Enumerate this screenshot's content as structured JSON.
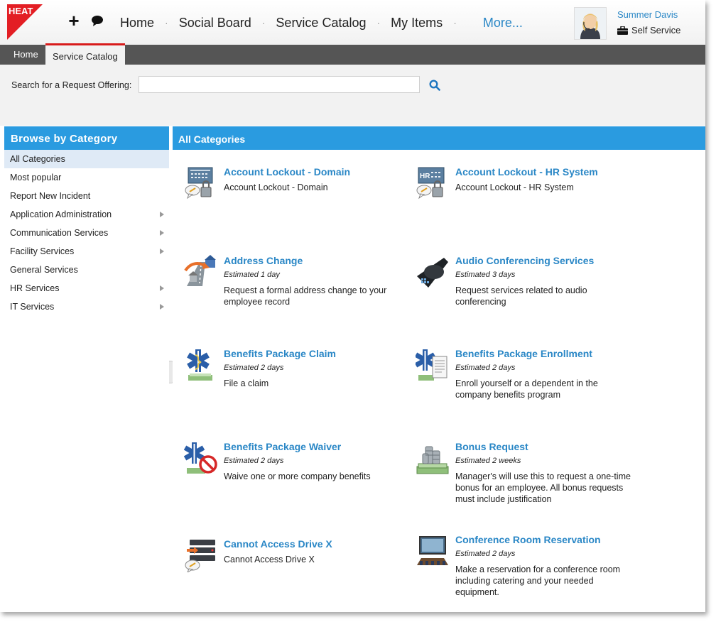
{
  "app": {
    "logo_text": "HEAT",
    "brand_color": "#e31e24",
    "accent_color": "#2a9be0"
  },
  "header": {
    "add_icon": "plus-icon",
    "chat_icon": "speech-bubble-icon",
    "nav": [
      {
        "label": "Home"
      },
      {
        "label": "Social Board"
      },
      {
        "label": "Service Catalog"
      },
      {
        "label": "My Items"
      }
    ],
    "more_label": "More...",
    "user": {
      "name": "Summer Davis",
      "role": "Self Service",
      "role_icon": "briefcase-icon"
    }
  },
  "tabs": {
    "home": "Home",
    "active": "Service Catalog"
  },
  "search": {
    "label": "Search for a Request Offering:",
    "value": "",
    "placeholder": "",
    "icon": "search-icon"
  },
  "sidebar": {
    "title": "Browse by Category",
    "items": [
      {
        "label": "All Categories",
        "selected": true,
        "has_children": false
      },
      {
        "label": "Most popular",
        "selected": false,
        "has_children": false
      },
      {
        "label": "Report New Incident",
        "selected": false,
        "has_children": false
      },
      {
        "label": "Application Administration",
        "selected": false,
        "has_children": true
      },
      {
        "label": "Communication Services",
        "selected": false,
        "has_children": true
      },
      {
        "label": "Facility Services",
        "selected": false,
        "has_children": true
      },
      {
        "label": "General Services",
        "selected": false,
        "has_children": false
      },
      {
        "label": "HR Services",
        "selected": false,
        "has_children": true
      },
      {
        "label": "IT Services",
        "selected": false,
        "has_children": true
      }
    ]
  },
  "main": {
    "title": "All Categories",
    "offerings": [
      {
        "title": "Account Lockout - Domain",
        "estimate": "",
        "description": "Account Lockout - Domain",
        "icon": "account-lockout-domain-icon"
      },
      {
        "title": "Account Lockout - HR System",
        "estimate": "",
        "description": "Account Lockout - HR System",
        "icon": "account-lockout-hr-icon"
      },
      {
        "title": "Address Change",
        "estimate": "Estimated 1 day",
        "description": "Request a formal address change to your employee record",
        "icon": "address-change-icon"
      },
      {
        "title": "Audio Conferencing Services",
        "estimate": "Estimated 3 days",
        "description": "Request services related to audio conferencing",
        "icon": "conference-phone-icon"
      },
      {
        "title": "Benefits Package Claim",
        "estimate": "Estimated 2 days",
        "description": "File a claim",
        "icon": "benefits-claim-icon"
      },
      {
        "title": "Benefits Package Enrollment",
        "estimate": "Estimated 2 days",
        "description": "Enroll yourself or a dependent in the company benefits program",
        "icon": "benefits-enrollment-icon"
      },
      {
        "title": "Benefits Package Waiver",
        "estimate": "Estimated 2 days",
        "description": "Waive one or more company benefits",
        "icon": "benefits-waiver-icon"
      },
      {
        "title": "Bonus Request",
        "estimate": "Estimated 2 weeks",
        "description": "Manager's will use this to request a one-time bonus for an employee. All bonus requests must include justification",
        "icon": "money-bonus-icon"
      },
      {
        "title": "Cannot Access Drive X",
        "estimate": "",
        "description": "Cannot Access Drive X",
        "icon": "drive-access-icon"
      },
      {
        "title": "Conference Room Reservation",
        "estimate": "Estimated 2 days",
        "description": "Make a reservation for a conference room including catering and your needed equipment.",
        "icon": "conference-room-icon"
      }
    ]
  }
}
